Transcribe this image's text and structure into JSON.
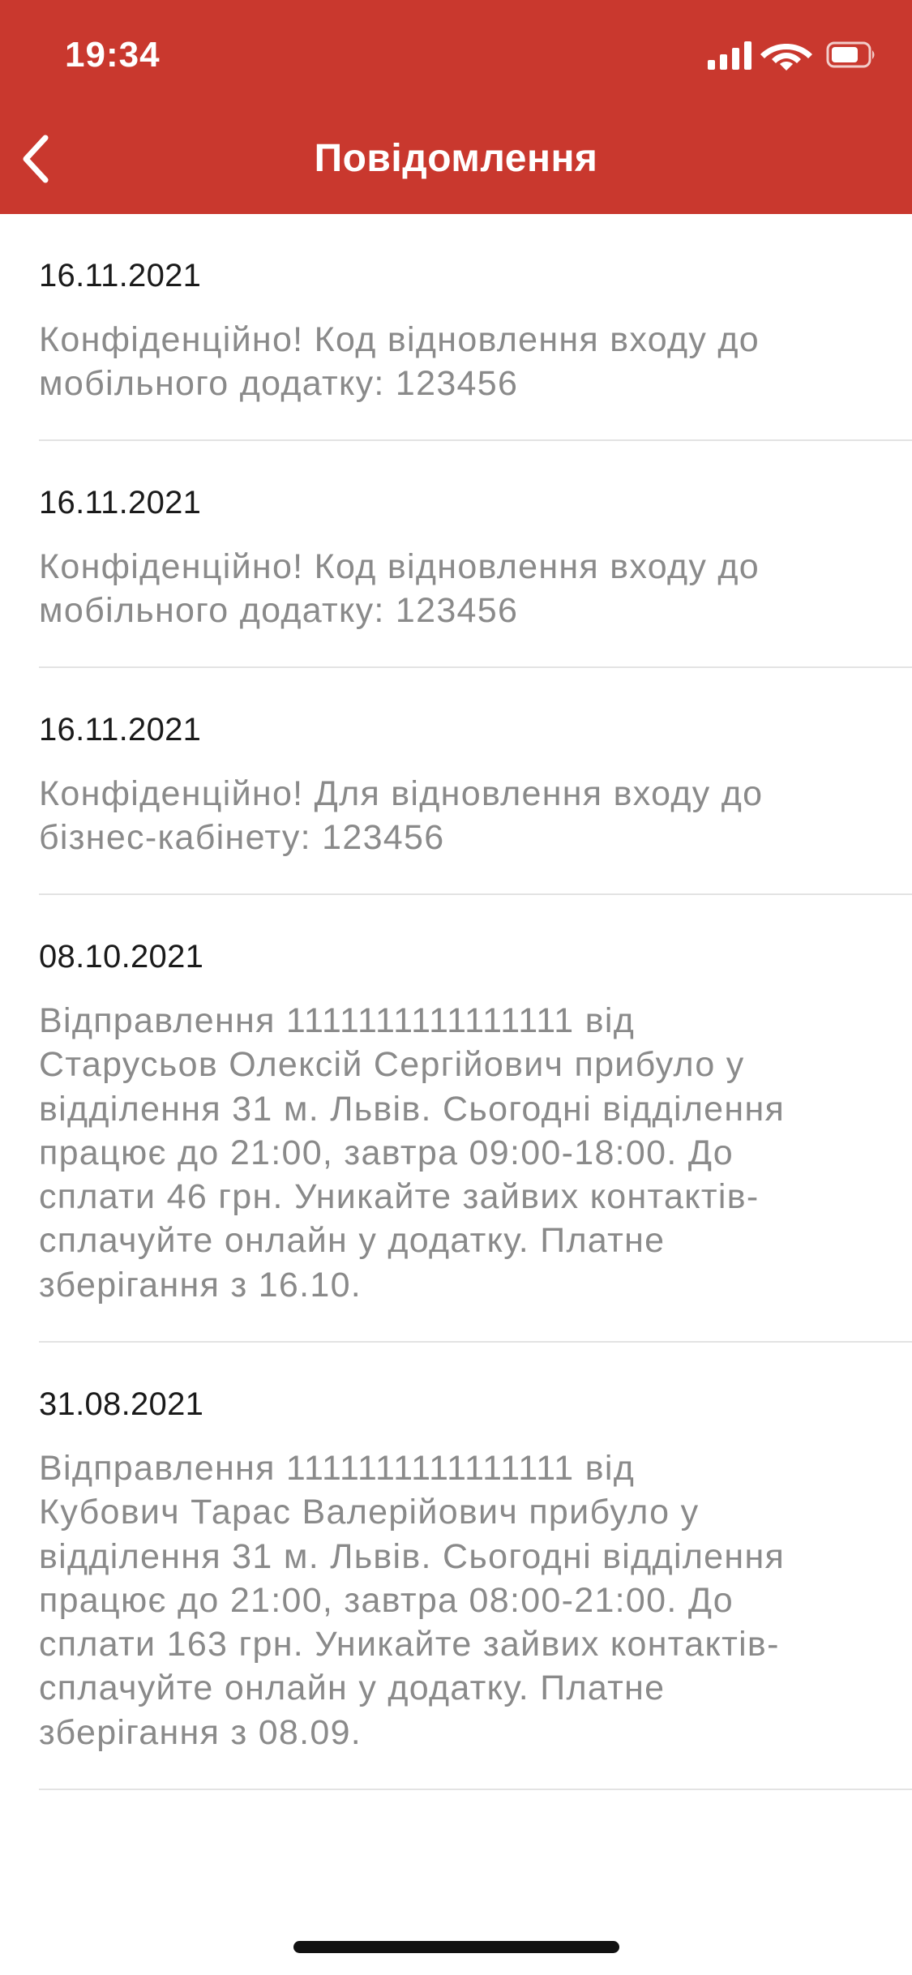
{
  "status_bar": {
    "time": "19:34"
  },
  "header": {
    "title": "Повідомлення",
    "background_color": "#c9382e"
  },
  "messages": [
    {
      "date": "16.11.2021",
      "text": "Конфіденційно! Код відновлення входу до\nмобільного додатку: 123456"
    },
    {
      "date": "16.11.2021",
      "text": "Конфіденційно! Код відновлення входу до\nмобільного додатку: 123456"
    },
    {
      "date": "16.11.2021",
      "text": "Конфіденційно! Для відновлення входу до\nбізнес-кабінету: 123456"
    },
    {
      "date": "08.10.2021",
      "text": "Відправлення 1111111111111111 від\nСтарусьов Олексій Сергійович прибуло у\nвідділення 31 м. Львів. Сьогодні відділення\nпрацює до 21:00, завтра 09:00-18:00. До\nсплати 46 грн. Уникайте зайвих контактів-\nсплачуйте онлайн у додатку. Платне\nзберігання з 16.10."
    },
    {
      "date": "31.08.2021",
      "text": "Відправлення  1111111111111111  від\nКубович Тарас Валерійович прибуло у\nвідділення 31 м. Львів. Сьогодні відділення\nпрацює до 21:00, завтра 08:00-21:00. До\nсплати 163 грн. Уникайте зайвих контактів-\nсплачуйте онлайн у додатку. Платне\nзберігання з 08.09."
    }
  ],
  "icons": {
    "back": "chevron-left-icon",
    "signal": "cellular-signal-icon",
    "wifi": "wifi-icon",
    "battery": "battery-icon"
  }
}
